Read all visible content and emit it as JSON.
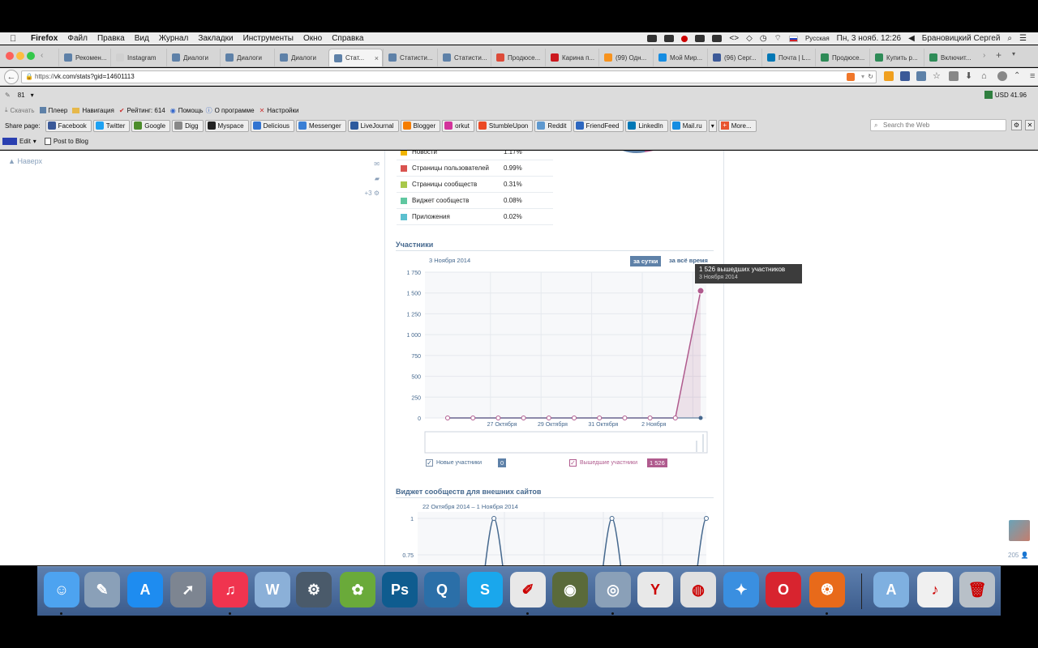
{
  "menubar": {
    "apple": "",
    "items": [
      "Firefox",
      "Файл",
      "Правка",
      "Вид",
      "Журнал",
      "Закладки",
      "Инструменты",
      "Окно",
      "Справка"
    ],
    "language": "Русская",
    "datetime": "Пн, 3 нояб.  12:26",
    "user": "Брановицкий Сергей"
  },
  "tabs": [
    {
      "label": "Рекомен...",
      "fav": "#5e81a8"
    },
    {
      "label": "Instagram",
      "fav": "#d0d0d0"
    },
    {
      "label": "Диалоги",
      "fav": "#5e81a8"
    },
    {
      "label": "Диалоги",
      "fav": "#5e81a8"
    },
    {
      "label": "Диалоги",
      "fav": "#5e81a8"
    },
    {
      "label": "Стат...",
      "fav": "#5e81a8"
    },
    {
      "label": "Статисти...",
      "fav": "#5e81a8"
    },
    {
      "label": "Статисти...",
      "fav": "#5e81a8"
    },
    {
      "label": "Продюсе...",
      "fav": "#dd4b39"
    },
    {
      "label": "Карина п...",
      "fav": "#cc181e"
    },
    {
      "label": "(99) Одн...",
      "fav": "#f7931e"
    },
    {
      "label": "Мой Мир...",
      "fav": "#168de2"
    },
    {
      "label": "(96) Серг...",
      "fav": "#3b5998"
    },
    {
      "label": "Почта | L...",
      "fav": "#0077b5"
    },
    {
      "label": "Продюсе...",
      "fav": "#2e8b57"
    },
    {
      "label": "Купить р...",
      "fav": "#2e8b57"
    },
    {
      "label": "Включит...",
      "fav": "#2e8b57"
    }
  ],
  "nav": {
    "url_prefix": "https://",
    "url": "vk.com/stats?gid=14601113"
  },
  "toolbar1": {
    "count": "81",
    "currency": "USD 41.96"
  },
  "toolbar2": {
    "download": "Скачать",
    "player": "Плеер",
    "navigation": "Навигация",
    "rating": "Рейтинг: 614",
    "help": "Помощь",
    "about": "О программе",
    "settings": "Настройки"
  },
  "share": {
    "label": "Share page:",
    "buttons": [
      "Facebook",
      "Twitter",
      "Google",
      "Digg",
      "Myspace",
      "Delicious",
      "Messenger",
      "LiveJournal",
      "Blogger",
      "orkut",
      "StumbleUpon",
      "Reddit",
      "FriendFeed",
      "LinkedIn",
      "Mail.ru"
    ],
    "more": "More...",
    "search_placeholder": "Search the Web"
  },
  "toolbar4": {
    "edit": "Edit",
    "post": "Post to Blog"
  },
  "page": {
    "back_to_top": "Наверх",
    "side_counter": "+3",
    "legend_rows": [
      {
        "label": "Новости",
        "value": "1.17%",
        "color": "#f0b400"
      },
      {
        "label": "Страницы пользователей",
        "value": "0.99%",
        "color": "#d9534f"
      },
      {
        "label": "Страницы сообществ",
        "value": "0.31%",
        "color": "#a8c84a"
      },
      {
        "label": "Виджет сообществ",
        "value": "0.08%",
        "color": "#5fc7a0"
      },
      {
        "label": "Приложения",
        "value": "0.02%",
        "color": "#5bc0cf"
      }
    ],
    "members_title": "Участники",
    "members_date": "3 Ноября 2014",
    "btn_day": "за сутки",
    "btn_all": "за всё время",
    "tooltip_title": "1 526 вышедших участников",
    "tooltip_date": "3 Ноября 2014",
    "new_members_label": "Новые участники",
    "new_members_count": "0",
    "left_members_label": "Вышедшие участники",
    "left_members_count": "1 526",
    "widget_title": "Виджет сообществ для внешних сайтов",
    "widget_range": "22 Октября 2014 – 1 Ноября 2014",
    "right_count": "205"
  },
  "chart_data": [
    {
      "type": "line",
      "title": "Участники",
      "ylim": [
        0,
        1750
      ],
      "yticks": [
        "1 750",
        "1 500",
        "1 250",
        "1 000",
        "750",
        "500",
        "250",
        "0"
      ],
      "xtick_labels": [
        "27 Октября",
        "29 Октября",
        "31 Октября",
        "2 Ноября"
      ],
      "series": [
        {
          "name": "Новые участники",
          "color": "#45688e",
          "values": [
            0,
            0,
            0,
            0,
            0,
            0,
            0,
            0,
            0,
            0,
            0
          ]
        },
        {
          "name": "Вышедшие участники",
          "color": "#b05b8e",
          "values": [
            0,
            0,
            0,
            0,
            0,
            0,
            0,
            0,
            0,
            0,
            1526
          ]
        }
      ]
    },
    {
      "type": "line",
      "title": "Виджет сообществ для внешних сайтов",
      "yticks": [
        "1",
        "0.75"
      ],
      "series": [
        {
          "values": [
            0,
            1,
            0,
            0,
            0,
            0,
            1,
            0,
            0,
            0,
            1
          ]
        }
      ]
    }
  ],
  "dock": [
    {
      "name": "finder-icon",
      "color": "#4da3f0",
      "glyph": "☺"
    },
    {
      "name": "preview-icon",
      "color": "#8aa0b8",
      "glyph": "✎"
    },
    {
      "name": "app-store-icon",
      "color": "#1e8cf0",
      "glyph": "A"
    },
    {
      "name": "launchpad-icon",
      "color": "#7d8591",
      "glyph": "➚"
    },
    {
      "name": "itunes-icon",
      "color": "#f0344f",
      "glyph": "♫"
    },
    {
      "name": "word-icon",
      "color": "#8bb0d8",
      "glyph": "W"
    },
    {
      "name": "tool-icon",
      "color": "#4a5a6a",
      "glyph": "⚙"
    },
    {
      "name": "frog-icon",
      "color": "#6aaa3a",
      "glyph": "✿"
    },
    {
      "name": "photoshop-icon",
      "color": "#0f5c8f",
      "glyph": "Ps"
    },
    {
      "name": "quicktime-icon",
      "color": "#2b6fa8",
      "glyph": "Q"
    },
    {
      "name": "skype-icon",
      "color": "#1aa7ec",
      "glyph": "S"
    },
    {
      "name": "textedit-icon",
      "color": "#e8e8e8",
      "glyph": "✐"
    },
    {
      "name": "video-icon",
      "color": "#5a6a3a",
      "glyph": "◉"
    },
    {
      "name": "disk-utility-icon",
      "color": "#8aa0b8",
      "glyph": "◎"
    },
    {
      "name": "yandex-browser-icon",
      "color": "#e8e8e8",
      "glyph": "Y"
    },
    {
      "name": "chrome-icon",
      "color": "#e0e0e0",
      "glyph": "◍"
    },
    {
      "name": "safari-icon",
      "color": "#3a8fe0",
      "glyph": "✦"
    },
    {
      "name": "opera-icon",
      "color": "#d8242f",
      "glyph": "O"
    },
    {
      "name": "firefox-icon",
      "color": "#e86a1a",
      "glyph": "❂"
    },
    {
      "name": "applications-folder-icon",
      "color": "#7fb0e0",
      "glyph": "A"
    },
    {
      "name": "mp3-icon",
      "color": "#f0f0f0",
      "glyph": "♪"
    },
    {
      "name": "trash-icon",
      "color": "#b8c0c8",
      "glyph": "🗑"
    }
  ]
}
